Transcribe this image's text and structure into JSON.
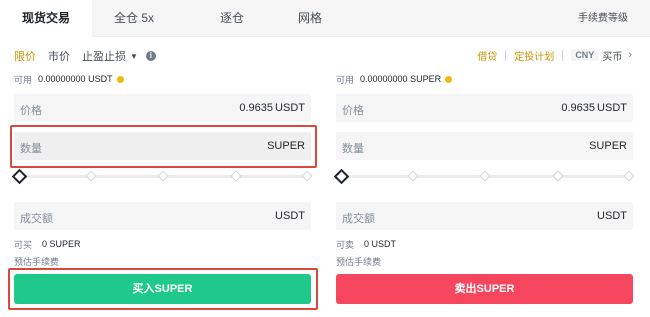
{
  "tabs": [
    "现货交易",
    "全仓 5x",
    "逐仓",
    "网格"
  ],
  "fee_link": "手续费等级",
  "order_types": {
    "limit": "限价",
    "market": "市价",
    "stop": "止盈止损"
  },
  "right_links": {
    "borrow": "借贷",
    "plan": "定投计划",
    "currency_badge": "CNY",
    "fiat": "买币"
  },
  "buy": {
    "available_label": "可用",
    "available_value": "0.00000000 USDT",
    "price_label": "价格",
    "price_value": "0.9635",
    "price_unit": "USDT",
    "qty_label": "数量",
    "qty_unit": "SUPER",
    "total_label": "成交额",
    "total_unit": "USDT",
    "can_label": "可买",
    "can_value": "0 SUPER",
    "est_fee_label": "预估手续费",
    "button": "买入SUPER"
  },
  "sell": {
    "available_label": "可用",
    "available_value": "0.00000000 SUPER",
    "price_label": "价格",
    "price_value": "0.9635",
    "price_unit": "USDT",
    "qty_label": "数量",
    "qty_unit": "SUPER",
    "total_label": "成交额",
    "total_unit": "USDT",
    "can_label": "可卖",
    "can_value": "0 USDT",
    "est_fee_label": "预估手续费",
    "button": "卖出SUPER"
  },
  "colors": {
    "accent": "#c99400",
    "buy": "#1ec98b",
    "sell": "#f6465d",
    "highlight": "#d9483b"
  }
}
